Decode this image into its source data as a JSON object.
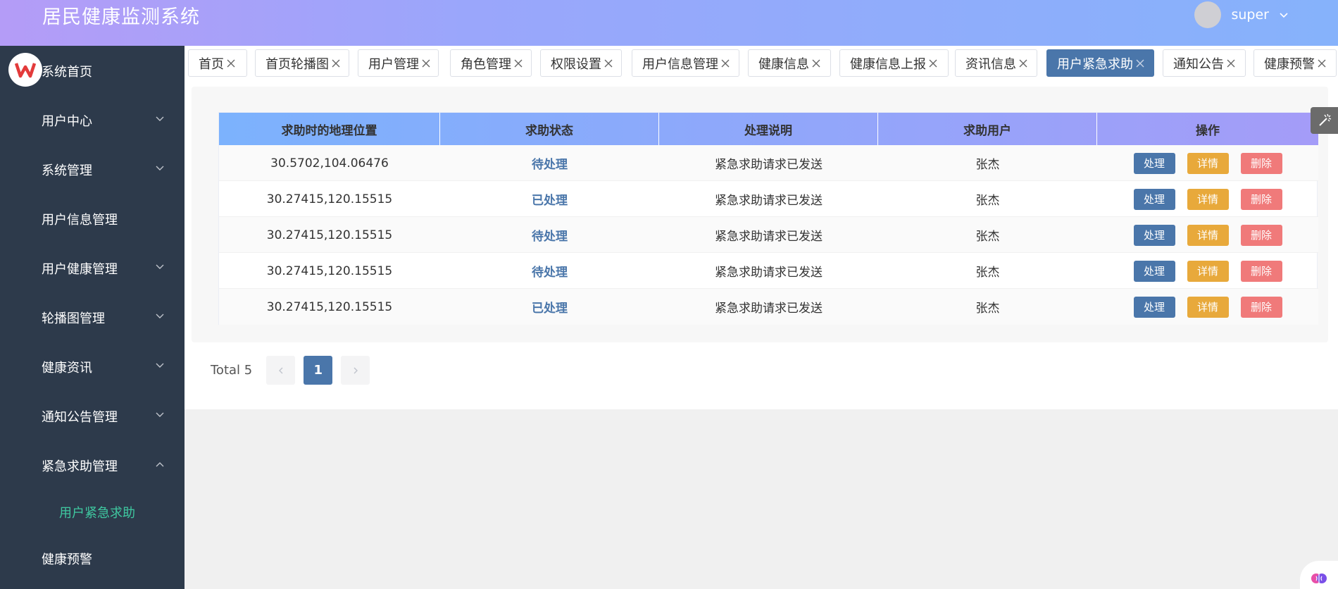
{
  "header": {
    "title": "居民健康监测系统",
    "username": "super"
  },
  "sidebar": {
    "items": [
      {
        "label": "系统首页"
      },
      {
        "label": "用户中心",
        "arrow": "down"
      },
      {
        "label": "系统管理",
        "arrow": "down"
      },
      {
        "label": "用户信息管理"
      },
      {
        "label": "用户健康管理",
        "arrow": "down"
      },
      {
        "label": "轮播图管理",
        "arrow": "down"
      },
      {
        "label": "健康资讯",
        "arrow": "down"
      },
      {
        "label": "通知公告管理",
        "arrow": "down"
      },
      {
        "label": "紧急求助管理",
        "arrow": "up"
      },
      {
        "label": "用户紧急求助",
        "sub": true
      },
      {
        "label": "健康预警"
      }
    ]
  },
  "tabs": [
    {
      "label": "首页"
    },
    {
      "label": "首页轮播图"
    },
    {
      "label": "用户管理"
    },
    {
      "label": "角色管理"
    },
    {
      "label": "权限设置"
    },
    {
      "label": "用户信息管理"
    },
    {
      "label": "健康信息"
    },
    {
      "label": "健康信息上报"
    },
    {
      "label": "资讯信息"
    },
    {
      "label": "用户紧急求助",
      "active": true
    },
    {
      "label": "通知公告"
    },
    {
      "label": "健康预警"
    }
  ],
  "table": {
    "columns": [
      "求助时的地理位置",
      "求助状态",
      "处理说明",
      "求助用户",
      "操作"
    ],
    "rows": [
      {
        "location": "30.5702,104.06476",
        "status": "待处理",
        "note": "紧急求助请求已发送",
        "user": "张杰"
      },
      {
        "location": "30.27415,120.15515",
        "status": "已处理",
        "note": "紧急求助请求已发送",
        "user": "张杰"
      },
      {
        "location": "30.27415,120.15515",
        "status": "待处理",
        "note": "紧急求助请求已发送",
        "user": "张杰"
      },
      {
        "location": "30.27415,120.15515",
        "status": "待处理",
        "note": "紧急求助请求已发送",
        "user": "张杰"
      },
      {
        "location": "30.27415,120.15515",
        "status": "已处理",
        "note": "紧急求助请求已发送",
        "user": "张杰"
      }
    ],
    "actions": {
      "handle": "处理",
      "detail": "详情",
      "delete": "删除"
    }
  },
  "pagination": {
    "total": "Total 5",
    "current": "1"
  },
  "colors": {
    "primary": "#4a76aa",
    "warning": "#e8a93b",
    "danger": "#f07a7a",
    "sidebar_bg": "#2d3a4b",
    "submenu_active": "#3fc8a0"
  }
}
